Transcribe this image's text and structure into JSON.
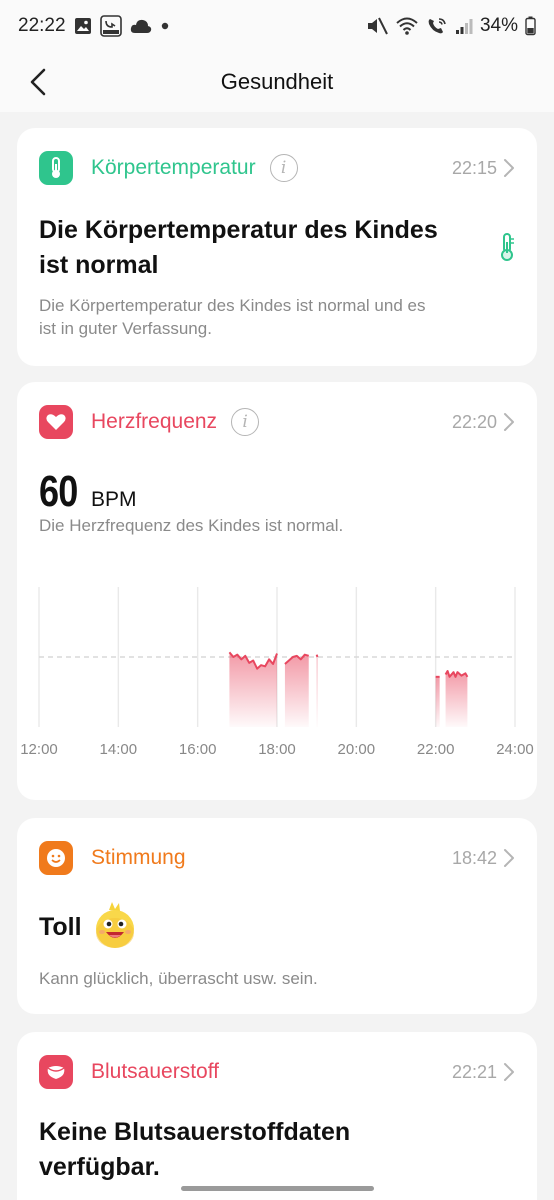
{
  "status_bar": {
    "time": "22:22",
    "battery": "34%",
    "left_icons": [
      "image-icon",
      "imoo-icon",
      "cloud-icon",
      "dot-icon"
    ],
    "right_icons": [
      "mute-icon",
      "wifi-icon",
      "wifi-call-icon",
      "signal-icon",
      "battery-icon"
    ]
  },
  "nav": {
    "title": "Gesundheit",
    "back_icon": "chevron-left-icon"
  },
  "cards": {
    "temperature": {
      "title": "Körpertemperatur",
      "time": "22:15",
      "headline_line1": "Die Körpertemperatur des Kindes",
      "headline_line2": "ist normal",
      "desc_line1": "Die Körpertemperatur des Kindes ist normal und es",
      "desc_line2": "ist in guter Verfassung.",
      "color": "#2fc58d"
    },
    "heart_rate": {
      "title": "Herzfrequenz",
      "time": "22:20",
      "value": "60",
      "unit": "BPM",
      "desc": "Die Herzfrequenz des Kindes ist normal.",
      "color": "#e8475f"
    },
    "mood": {
      "title": "Stimmung",
      "time": "18:42",
      "headline": "Toll",
      "desc": "Kann glücklich, überrascht usw. sein.",
      "color": "#f07a1c"
    },
    "blood_oxygen": {
      "title": "Blutsauerstoff",
      "time": "22:21",
      "headline_line1": "Keine Blutsauerstoffdaten",
      "headline_line2": "verfügbar.",
      "color": "#e8475f"
    }
  },
  "chart_data": {
    "type": "area",
    "x_ticks": [
      "12:00",
      "14:00",
      "16:00",
      "18:00",
      "20:00",
      "22:00",
      "24:00"
    ],
    "x_range_hours": [
      12,
      24
    ],
    "y_range": [
      0,
      120
    ],
    "reference_line": 60,
    "grid": true,
    "series": [
      {
        "segments": [
          [
            [
              16.8,
              64
            ],
            [
              16.9,
              60
            ],
            [
              17.0,
              62
            ],
            [
              17.1,
              58
            ],
            [
              17.2,
              61
            ],
            [
              17.3,
              55
            ],
            [
              17.4,
              57
            ],
            [
              17.5,
              50
            ],
            [
              17.6,
              53
            ],
            [
              17.7,
              52
            ],
            [
              17.8,
              58
            ],
            [
              17.9,
              54
            ],
            [
              18.0,
              63
            ]
          ],
          [
            [
              18.2,
              54
            ],
            [
              18.3,
              57
            ],
            [
              18.4,
              60
            ],
            [
              18.5,
              61
            ],
            [
              18.6,
              58
            ],
            [
              18.7,
              62
            ],
            [
              18.8,
              61
            ]
          ],
          [
            [
              19.0,
              62
            ],
            [
              19.02,
              60
            ]
          ],
          [
            [
              22.0,
              43
            ],
            [
              22.1,
              43
            ]
          ],
          [
            [
              22.25,
              45
            ],
            [
              22.3,
              48
            ],
            [
              22.35,
              43
            ],
            [
              22.45,
              47
            ],
            [
              22.5,
              43
            ],
            [
              22.55,
              47
            ],
            [
              22.65,
              44
            ],
            [
              22.75,
              46
            ],
            [
              22.8,
              43
            ]
          ]
        ]
      }
    ]
  }
}
